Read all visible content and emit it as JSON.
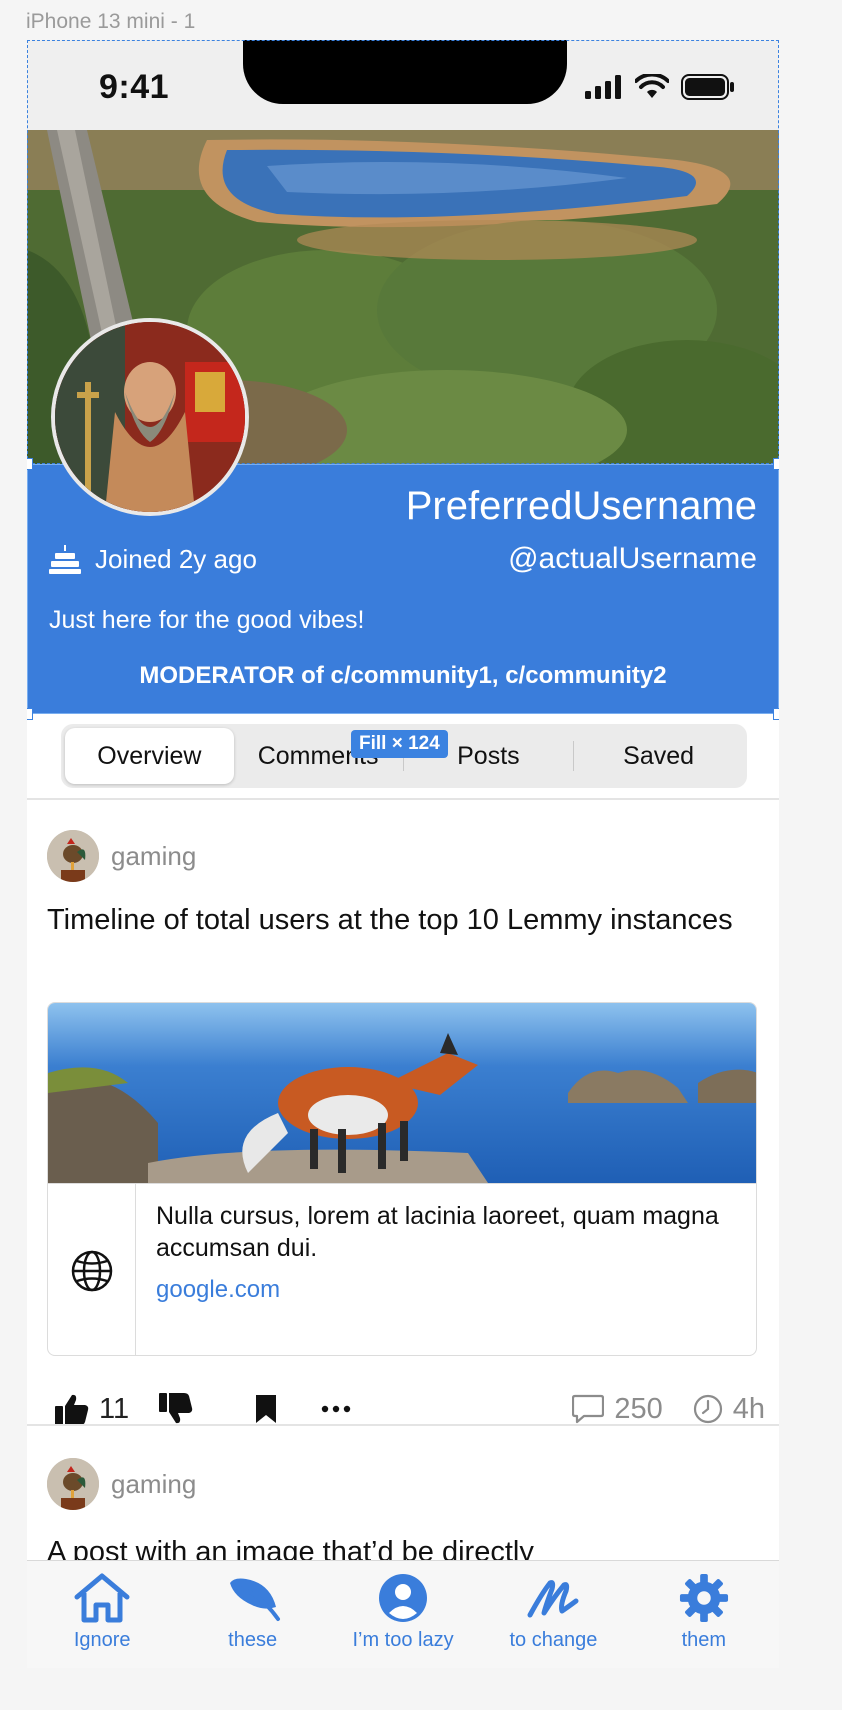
{
  "frame_label": "iPhone 13 mini - 1",
  "status_bar": {
    "time": "9:41"
  },
  "profile": {
    "preferred_name": "PreferredUsername",
    "handle": "@actualUsername",
    "joined": "Joined 2y ago",
    "bio": "Just here for the good vibes!",
    "moderator": "MODERATOR of c/community1, c/community2",
    "accent_color": "#3a7ddb"
  },
  "tabs": [
    {
      "label": "Overview",
      "active": true
    },
    {
      "label": "Comments",
      "active": false
    },
    {
      "label": "Posts",
      "active": false
    },
    {
      "label": "Saved",
      "active": false
    }
  ],
  "fill_badge": "Fill × 124",
  "posts": [
    {
      "community": "gaming",
      "title": "Timeline of total users at the top 10 Lemmy instances",
      "link": {
        "description": "Nulla cursus, lorem at lacinia laoreet, quam magna accumsan dui.",
        "url": "google.com"
      },
      "actions": {
        "upvotes": "11",
        "comments": "250",
        "age": "4h"
      }
    },
    {
      "community": "gaming",
      "title": "A post with an image that’d be directly"
    }
  ],
  "nav": [
    {
      "label": "Ignore",
      "icon": "home-icon"
    },
    {
      "label": "these",
      "icon": "leaf-icon"
    },
    {
      "label": "I’m too lazy",
      "icon": "user-circle-icon"
    },
    {
      "label": "to change",
      "icon": "scribble-icon"
    },
    {
      "label": "them",
      "icon": "gear-icon"
    }
  ]
}
